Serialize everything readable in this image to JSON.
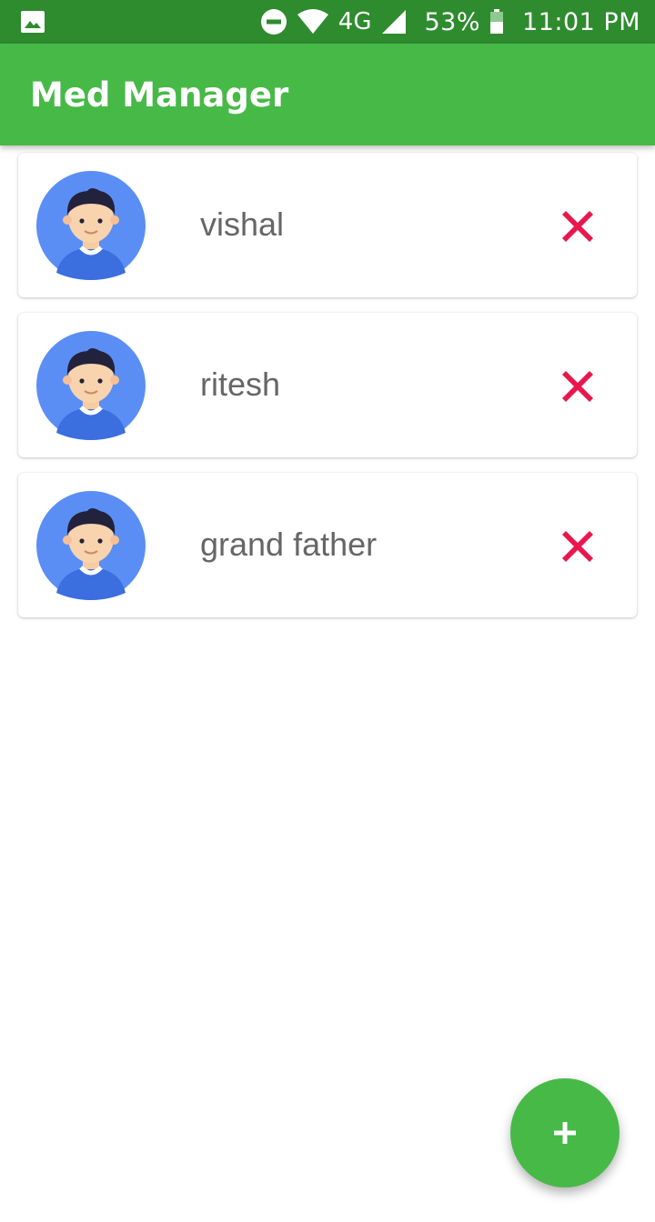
{
  "status_bar": {
    "network": "4G",
    "battery": "53%",
    "time": "11:01 PM",
    "icons": [
      "image-icon",
      "dnd-icon",
      "wifi-icon",
      "signal-icon",
      "battery-icon"
    ]
  },
  "app_bar": {
    "title": "Med Manager"
  },
  "members": [
    {
      "name": "vishal",
      "avatar_icon": "avatar-icon",
      "delete_icon": "close-icon"
    },
    {
      "name": "ritesh",
      "avatar_icon": "avatar-icon",
      "delete_icon": "close-icon"
    },
    {
      "name": "grand father",
      "avatar_icon": "avatar-icon",
      "delete_icon": "close-icon"
    }
  ],
  "fab": {
    "icon": "plus-icon"
  },
  "colors": {
    "status_bar": "#2e8b2e",
    "app_bar": "#47b947",
    "fab": "#47b947",
    "delete": "#e8174e",
    "avatar_bg": "#5b8ef5",
    "name_text": "#666666"
  }
}
